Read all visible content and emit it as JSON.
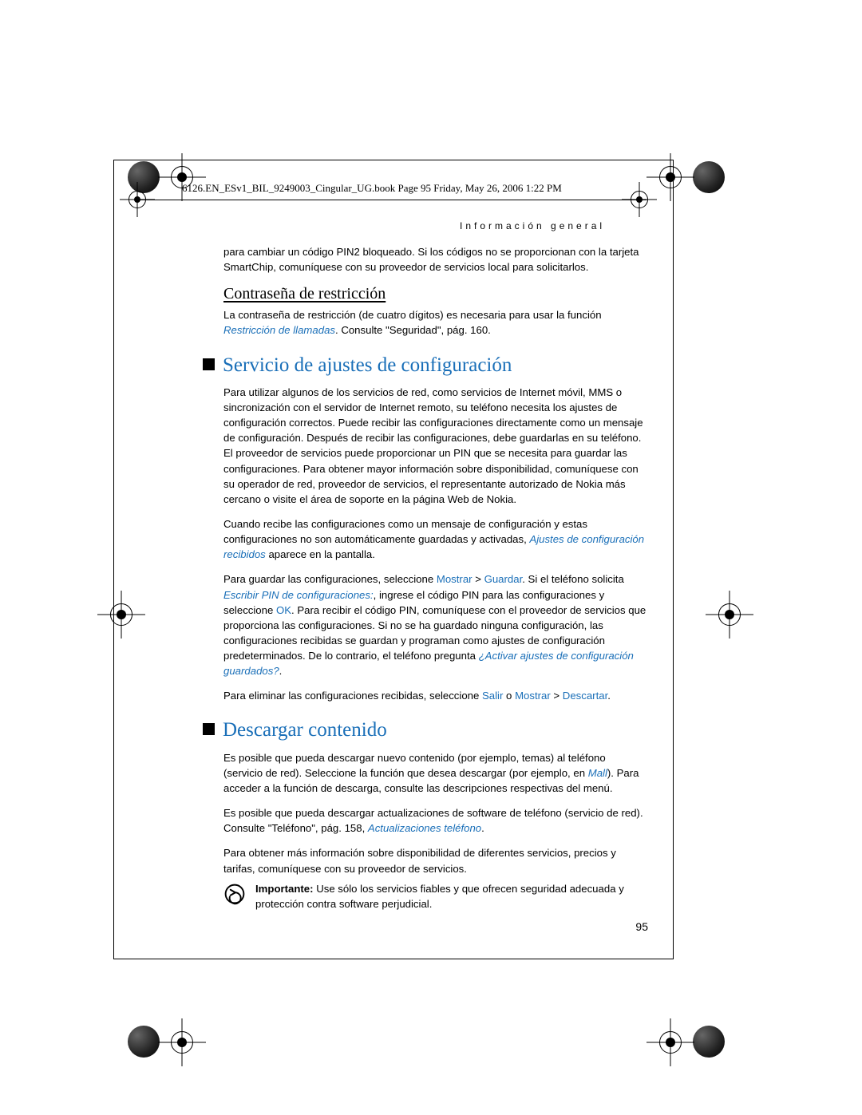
{
  "header": "6126.EN_ESv1_BIL_9249003_Cingular_UG.book  Page 95  Friday, May 26, 2006  1:22 PM",
  "section_right": "Información general",
  "p_intro": "para cambiar un código PIN2 bloqueado. Si los códigos no se proporcionan con la tarjeta SmartChip, comuníquese con su proveedor de servicios local para solicitarlos.",
  "sub1": "Contraseña de restricción",
  "p_sub1_a": "La contraseña de restricción (de cuatro dígitos) es necesaria para usar la función ",
  "p_sub1_link": "Restricción de llamadas",
  "p_sub1_b": ". Consulte \"Seguridad\", pág. 160.",
  "sec1": "Servicio de ajustes de configuración",
  "p_sec1_1": "Para utilizar algunos de los servicios de red, como servicios de Internet móvil, MMS o sincronización con el servidor de Internet remoto, su teléfono necesita los ajustes de configuración correctos. Puede recibir las configuraciones directamente como un mensaje de configuración. Después de recibir las configuraciones, debe guardarlas en su teléfono. El proveedor de servicios puede proporcionar un PIN que se necesita para guardar las configuraciones. Para obtener mayor información sobre disponibilidad, comuníquese con su operador de red, proveedor de servicios, el representante autorizado de Nokia más cercano o visite el área de soporte en la  página Web de Nokia.",
  "p_sec1_2a": "Cuando recibe las configuraciones como un mensaje de configuración y estas configuraciones no son automáticamente guardadas y activadas, ",
  "p_sec1_2link": "Ajustes de configuración recibidos",
  "p_sec1_2b": "  aparece en la pantalla.",
  "p_sec1_3a": "Para guardar las configuraciones, seleccione ",
  "ui_mostrar": "Mostrar",
  "gt": " > ",
  "ui_guardar": "Guardar",
  "p_sec1_3b": ". Si el teléfono solicita ",
  "link_pin": "Escribir PIN de configuraciones:",
  "p_sec1_3c": ", ingrese el código PIN para las configuraciones y seleccione ",
  "ui_ok": "OK",
  "p_sec1_3d": ". Para recibir el código PIN, comuníquese con el proveedor de servicios que proporciona las configuraciones. Si no se ha guardado ninguna configuración, las configuraciones recibidas se guardan y programan como ajustes de configuración predeterminados. De lo contrario, el teléfono pregunta ",
  "link_activar": "¿Activar ajustes de configuración guardados?",
  "p_sec1_3e": ".",
  "p_sec1_4a": "Para eliminar las configuraciones recibidas, seleccione ",
  "ui_salir": "Salir",
  "p_sec1_4b": " o ",
  "ui_descartar": "Descartar",
  "p_sec1_4c": ".",
  "sec2": "Descargar contenido",
  "p_sec2_1a": "Es posible que pueda descargar nuevo contenido (por ejemplo, temas) al teléfono (servicio de red). Seleccione la función que desea descargar (por ejemplo, en ",
  "link_mall": "Mall",
  "p_sec2_1b": "). Para acceder a la función de descarga, consulte las descripciones respectivas del menú.",
  "p_sec2_2a": "Es posible que pueda descargar actualizaciones de software de teléfono (servicio de red). Consulte \"Teléfono\", pág. 158, ",
  "link_act": "Actualizaciones teléfono",
  "p_sec2_2b": ".",
  "p_sec2_3": "Para obtener más información sobre disponibilidad de diferentes servicios, precios y tarifas, comuníquese con su proveedor de servicios.",
  "imp_label": "Importante:",
  "imp_text": " Use sólo los servicios fiables y que ofrecen seguridad adecuada y protección contra software perjudicial.",
  "page_num": "95"
}
